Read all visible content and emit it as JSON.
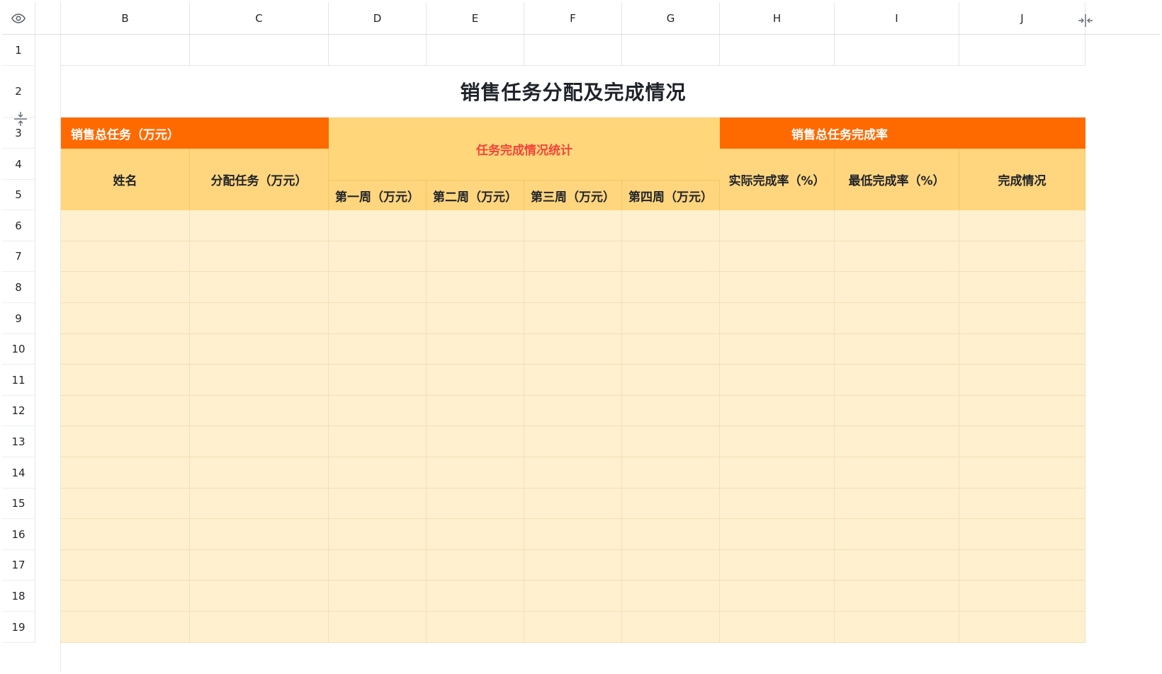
{
  "columns": [
    "B",
    "C",
    "D",
    "E",
    "F",
    "G",
    "H",
    "I",
    "J"
  ],
  "rows": [
    "1",
    "2",
    "3",
    "4",
    "5",
    "6",
    "7",
    "8",
    "9",
    "10",
    "11",
    "12",
    "13",
    "14",
    "15",
    "16",
    "17",
    "18",
    "19"
  ],
  "sheet": {
    "title": "销售任务分配及完成情况",
    "header": {
      "total_task": "销售总任务（万元）",
      "completion_stats": "任务完成情况统计",
      "total_completion_rate": "销售总任务完成率",
      "name": "姓名",
      "assigned_task": "分配任务（万元）",
      "week1": "第一周（万元）",
      "week2": "第二周（万元）",
      "week3": "第三周（万元）",
      "week4": "第四周（万元）",
      "actual_rate": "实际完成率（%）",
      "min_rate": "最低完成率（%）",
      "status": "完成情况"
    }
  },
  "colors": {
    "orange_header": "#ff6a00",
    "gold_header": "#ffd77a",
    "light_header": "#ffd57e",
    "data_fill": "#fff0cf",
    "red_text": "#f5433b"
  },
  "icons": {
    "corner": "eye-icon",
    "row_resize": "row-resize-icon",
    "col_resize": "column-resize-icon"
  }
}
